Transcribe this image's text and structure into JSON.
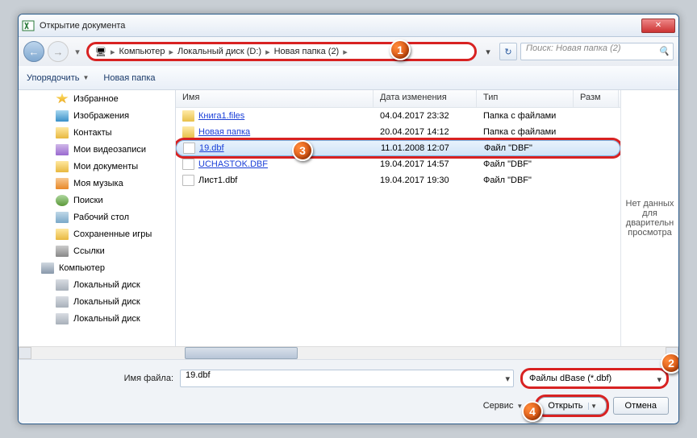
{
  "window": {
    "title": "Открытие документа"
  },
  "breadcrumb": {
    "segments": [
      "Компьютер",
      "Локальный диск (D:)",
      "Новая папка (2)"
    ]
  },
  "search": {
    "placeholder": "Поиск: Новая папка (2)"
  },
  "toolbar": {
    "organize": "Упорядочить",
    "newfolder": "Новая папка"
  },
  "sidebar": {
    "items": [
      {
        "label": "Избранное",
        "icon": "i-star",
        "lvl": 1
      },
      {
        "label": "Изображения",
        "icon": "i-pic",
        "lvl": 1
      },
      {
        "label": "Контакты",
        "icon": "i-fold",
        "lvl": 1
      },
      {
        "label": "Мои видеозаписи",
        "icon": "i-vid",
        "lvl": 1
      },
      {
        "label": "Мои документы",
        "icon": "i-fold",
        "lvl": 1
      },
      {
        "label": "Моя музыка",
        "icon": "i-mus",
        "lvl": 1
      },
      {
        "label": "Поиски",
        "icon": "i-srch",
        "lvl": 1
      },
      {
        "label": "Рабочий стол",
        "icon": "i-desk",
        "lvl": 1
      },
      {
        "label": "Сохраненные игры",
        "icon": "i-fold",
        "lvl": 1
      },
      {
        "label": "Ссылки",
        "icon": "i-link",
        "lvl": 1
      },
      {
        "label": "Компьютер",
        "icon": "i-comp",
        "lvl": 0
      },
      {
        "label": "Локальный диск",
        "icon": "i-drv",
        "lvl": 1
      },
      {
        "label": "Локальный диск",
        "icon": "i-drv",
        "lvl": 1
      },
      {
        "label": "Локальный диск",
        "icon": "i-drv",
        "lvl": 1
      }
    ]
  },
  "columns": {
    "name": "Имя",
    "date": "Дата изменения",
    "type": "Тип",
    "size": "Разм"
  },
  "files": [
    {
      "name": "Книга1.files",
      "date": "04.04.2017 23:32",
      "type": "Папка с файлами",
      "icon": "f-fold",
      "link": true
    },
    {
      "name": "Новая папка",
      "date": "20.04.2017 14:12",
      "type": "Папка с файлами",
      "icon": "f-fold",
      "link": true
    },
    {
      "name": "19.dbf",
      "date": "11.01.2008 12:07",
      "type": "Файл \"DBF\"",
      "icon": "f-file",
      "link": true,
      "sel": true,
      "hilite": true
    },
    {
      "name": "UCHASTOK.DBF",
      "date": "19.04.2017 14:57",
      "type": "Файл \"DBF\"",
      "icon": "f-file",
      "link": true
    },
    {
      "name": "Лист1.dbf",
      "date": "19.04.2017 19:30",
      "type": "Файл \"DBF\"",
      "icon": "f-file"
    }
  ],
  "preview": {
    "text": "Нет данных для дварительн просмотра"
  },
  "footer": {
    "filename_label": "Имя файла:",
    "filename_value": "19.dbf",
    "filter_value": "Файлы dBase (*.dbf)",
    "service": "Сервис",
    "open": "Открыть",
    "cancel": "Отмена"
  },
  "markers": {
    "m1": "1",
    "m2": "2",
    "m3": "3",
    "m4": "4"
  }
}
